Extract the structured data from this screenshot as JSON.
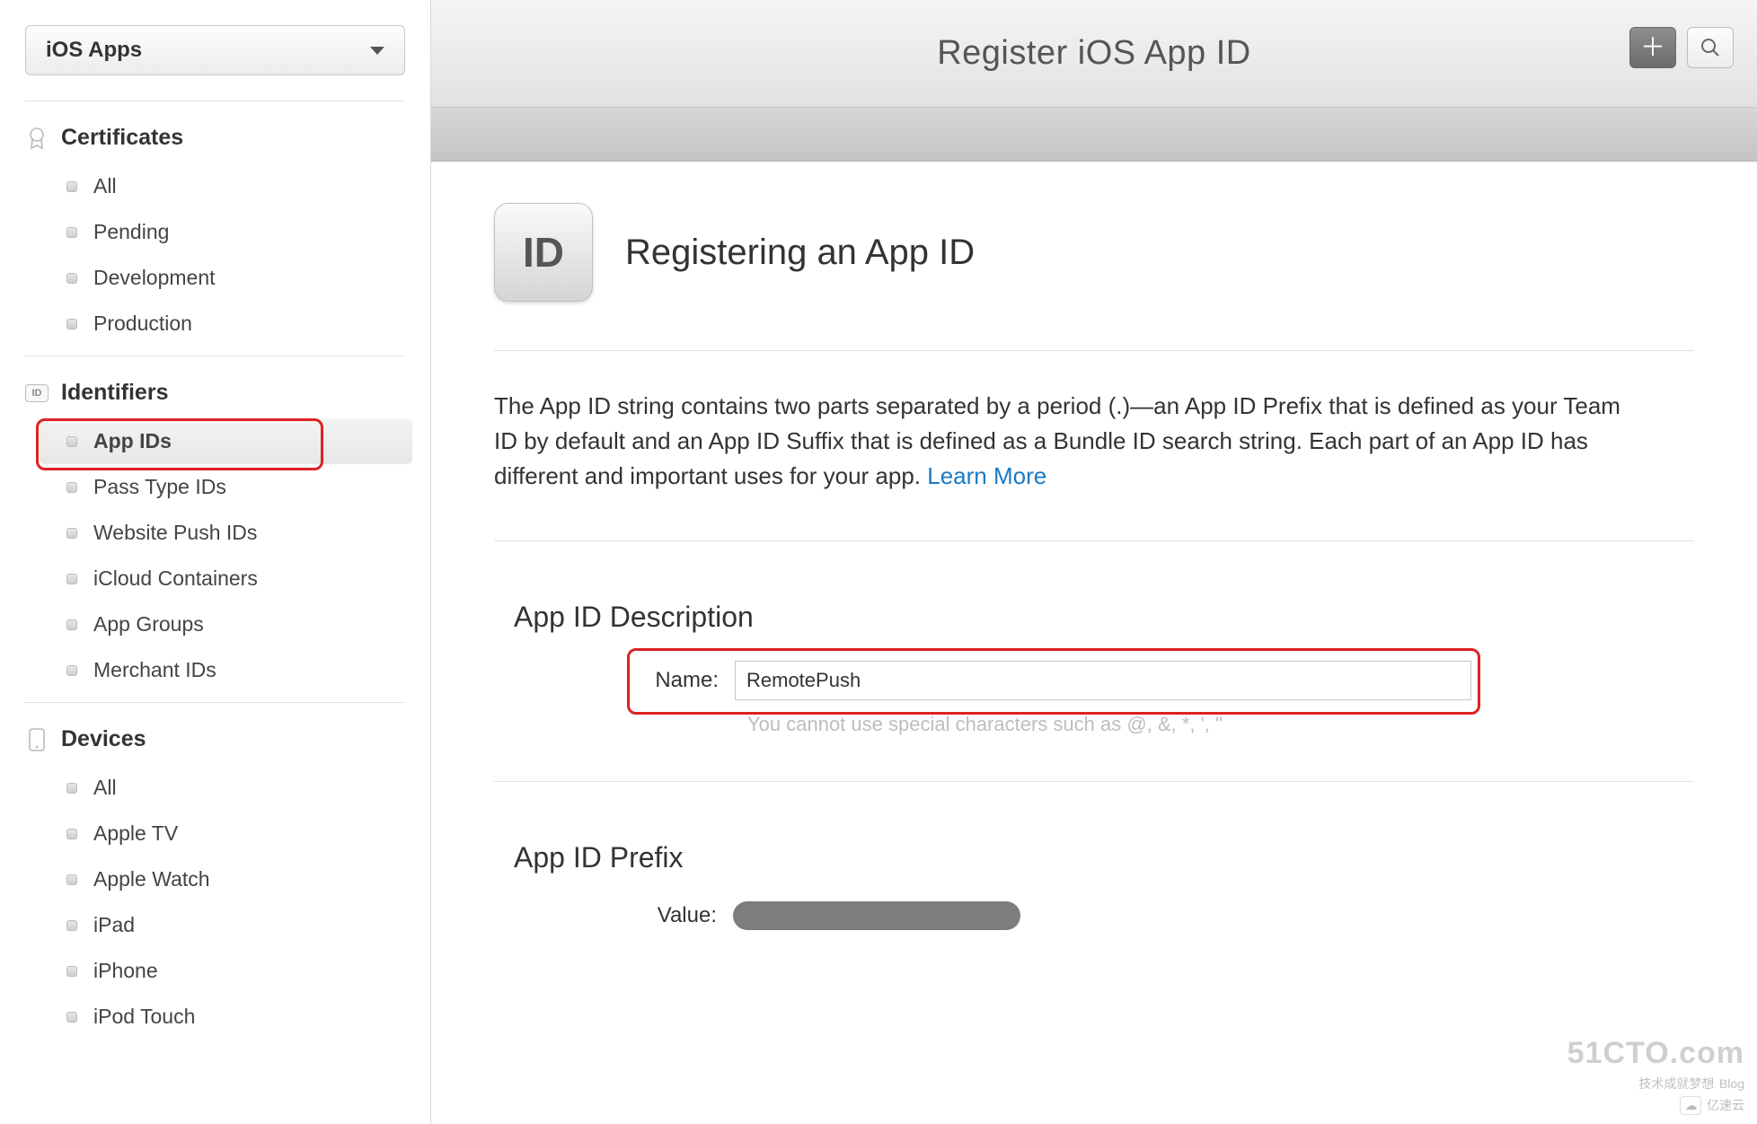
{
  "sidebar": {
    "platform_label": "iOS Apps",
    "groups": [
      {
        "key": "certificates",
        "label": "Certificates",
        "items": [
          {
            "label": "All"
          },
          {
            "label": "Pending"
          },
          {
            "label": "Development"
          },
          {
            "label": "Production"
          }
        ]
      },
      {
        "key": "identifiers",
        "label": "Identifiers",
        "items": [
          {
            "label": "App IDs",
            "active": true
          },
          {
            "label": "Pass Type IDs"
          },
          {
            "label": "Website Push IDs"
          },
          {
            "label": "iCloud Containers"
          },
          {
            "label": "App Groups"
          },
          {
            "label": "Merchant IDs"
          }
        ]
      },
      {
        "key": "devices",
        "label": "Devices",
        "items": [
          {
            "label": "All"
          },
          {
            "label": "Apple TV"
          },
          {
            "label": "Apple Watch"
          },
          {
            "label": "iPad"
          },
          {
            "label": "iPhone"
          },
          {
            "label": "iPod Touch"
          }
        ]
      }
    ]
  },
  "header": {
    "title": "Register iOS App ID"
  },
  "hero": {
    "badge": "ID",
    "heading": "Registering an App ID"
  },
  "intro": {
    "text": "The App ID string contains two parts separated by a period (.)—an App ID Prefix that is defined as your Team ID by default and an App ID Suffix that is defined as a Bundle ID search string. Each part of an App ID has different and important uses for your app. ",
    "learn_more": "Learn More"
  },
  "description_section": {
    "title": "App ID Description",
    "name_label": "Name:",
    "name_value": "RemotePush",
    "helper": "You cannot use special characters such as @, &, *, ', \""
  },
  "prefix_section": {
    "title": "App ID Prefix",
    "value_label": "Value:"
  },
  "watermark": {
    "site": "51CTO.com",
    "line2": "技术成就梦想",
    "blog": "Blog",
    "source": "亿速云"
  }
}
